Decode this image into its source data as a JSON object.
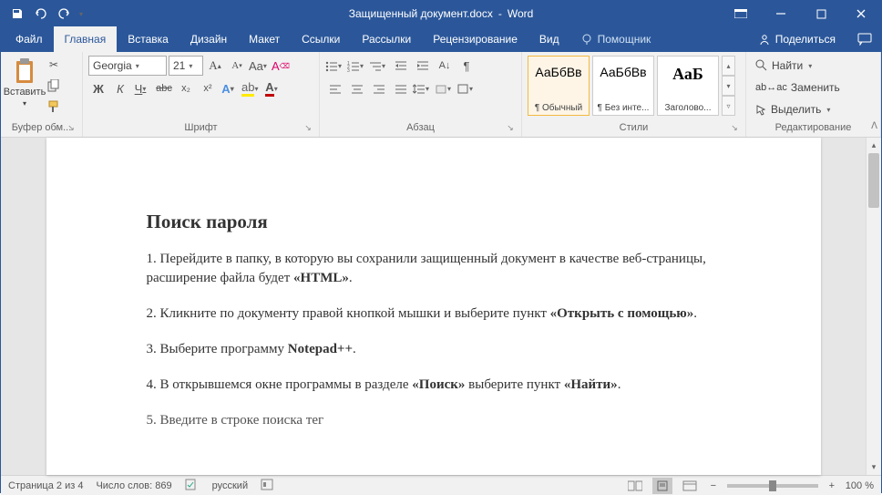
{
  "titlebar": {
    "doc_title": "Защищенный документ.docx",
    "app_name": "Word"
  },
  "tabs": {
    "file": "Файл",
    "home": "Главная",
    "insert": "Вставка",
    "design": "Дизайн",
    "layout": "Макет",
    "references": "Ссылки",
    "mailings": "Рассылки",
    "review": "Рецензирование",
    "view": "Вид",
    "tellme": "Помощник",
    "share": "Поделиться"
  },
  "ribbon": {
    "clipboard": {
      "label": "Буфер обм...",
      "paste": "Вставить"
    },
    "font": {
      "label": "Шрифт",
      "name": "Georgia",
      "size": "21",
      "bold": "Ж",
      "italic": "К",
      "underline": "Ч",
      "strike": "abc",
      "sub": "x₂",
      "sup": "x²"
    },
    "paragraph": {
      "label": "Абзац"
    },
    "styles": {
      "label": "Стили",
      "items": [
        {
          "preview": "АаБбВв",
          "name": "¶ Обычный"
        },
        {
          "preview": "АаБбВв",
          "name": "¶ Без инте..."
        },
        {
          "preview": "АаБ",
          "name": "Заголово..."
        }
      ]
    },
    "editing": {
      "label": "Редактирование",
      "find": "Найти",
      "replace": "Заменить",
      "select": "Выделить"
    }
  },
  "document": {
    "heading": "Поиск пароля",
    "p1a": "1. Перейдите в папку, в которую вы сохранили защищенный документ в качестве веб-страницы, расширение файла будет ",
    "p1b": "«HTML»",
    "p1c": ".",
    "p2a": "2. Кликните по документу правой кнопкой мышки и выберите пункт ",
    "p2b": "«Открыть с помощью»",
    "p2c": ".",
    "p3a": "3. Выберите программу ",
    "p3b": "Notepad++",
    "p3c": ".",
    "p4a": "4. В открывшемся окне программы в разделе ",
    "p4b": "«Поиск»",
    "p4c": " выберите пункт ",
    "p4d": "«Найти»",
    "p4e": ".",
    "p5": "5. Введите в строке поиска тег"
  },
  "statusbar": {
    "page": "Страница 2 из 4",
    "words": "Число слов: 869",
    "lang": "русский",
    "zoom": "100 %"
  }
}
